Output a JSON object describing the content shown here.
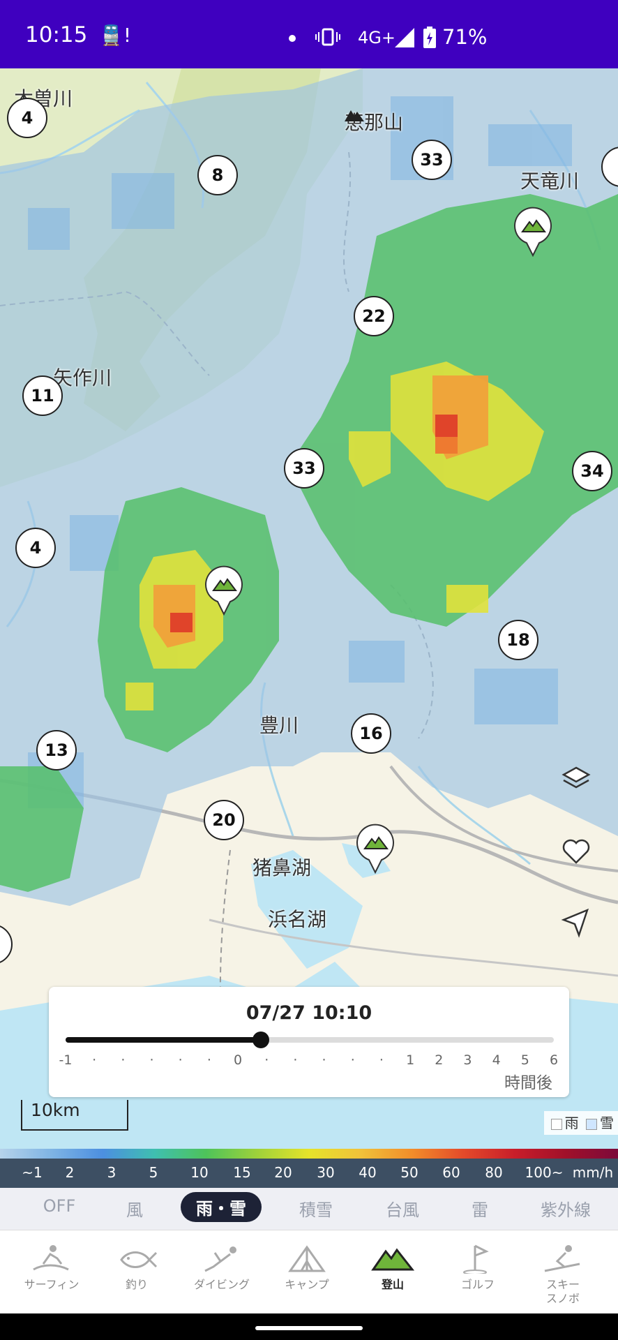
{
  "status_bar": {
    "time": "10:15",
    "train_icon": "train-alert-icon",
    "network": "4G+",
    "battery": "71%"
  },
  "map": {
    "places": [
      {
        "name": "木曽川"
      },
      {
        "name": "恵那山"
      },
      {
        "name": "天竜川"
      },
      {
        "name": "矢作川"
      },
      {
        "name": "豊川"
      },
      {
        "name": "猪鼻湖"
      },
      {
        "name": "浜名湖"
      }
    ],
    "routes": [
      "4",
      "8",
      "33",
      "22",
      "11",
      "33",
      "34",
      "4",
      "18",
      "16",
      "13",
      "20"
    ],
    "pin_icon": "mountain-pin-icon",
    "controls": [
      "layers-icon",
      "favorite-icon",
      "locate-icon"
    ]
  },
  "time_slider": {
    "datetime": "07/27 10:10",
    "position": 0.4,
    "ticks": [
      "-1",
      "·",
      "·",
      "·",
      "·",
      "·",
      "0",
      "·",
      "·",
      "·",
      "·",
      "·",
      "1",
      "2",
      "3",
      "4",
      "5",
      "6"
    ],
    "suffix": "時間後"
  },
  "scale_bar": "10km",
  "rain_snow_legend": {
    "rain": "雨",
    "snow": "雪"
  },
  "precip_legend": {
    "values": [
      "~1",
      "2",
      "3",
      "5",
      "10",
      "15",
      "20",
      "30",
      "40",
      "50",
      "60",
      "80",
      "100~",
      "mm/h"
    ],
    "colors": [
      "#b6d3ea",
      "#7fb4e4",
      "#4c8fe0",
      "#3fbfb0",
      "#4ec35a",
      "#9fd23a",
      "#e6e32a",
      "#f0c23a",
      "#f28d2a",
      "#e44a2a",
      "#c81e2a",
      "#a0102a",
      "#7c0a3a"
    ]
  },
  "layer_tabs": [
    "OFF",
    "風",
    "雨・雪",
    "積雪",
    "台風",
    "雷",
    "紫外線"
  ],
  "active_layer": "雨・雪",
  "bottom_nav": [
    {
      "label": "サーフィン",
      "icon": "surfing-icon"
    },
    {
      "label": "釣り",
      "icon": "fishing-icon"
    },
    {
      "label": "ダイビング",
      "icon": "diving-icon"
    },
    {
      "label": "キャンプ",
      "icon": "camping-icon"
    },
    {
      "label": "登山",
      "icon": "mountain-icon",
      "active": true
    },
    {
      "label": "ゴルフ",
      "icon": "golf-icon"
    },
    {
      "label": "スキー\nスノボ",
      "icon": "ski-icon"
    }
  ]
}
